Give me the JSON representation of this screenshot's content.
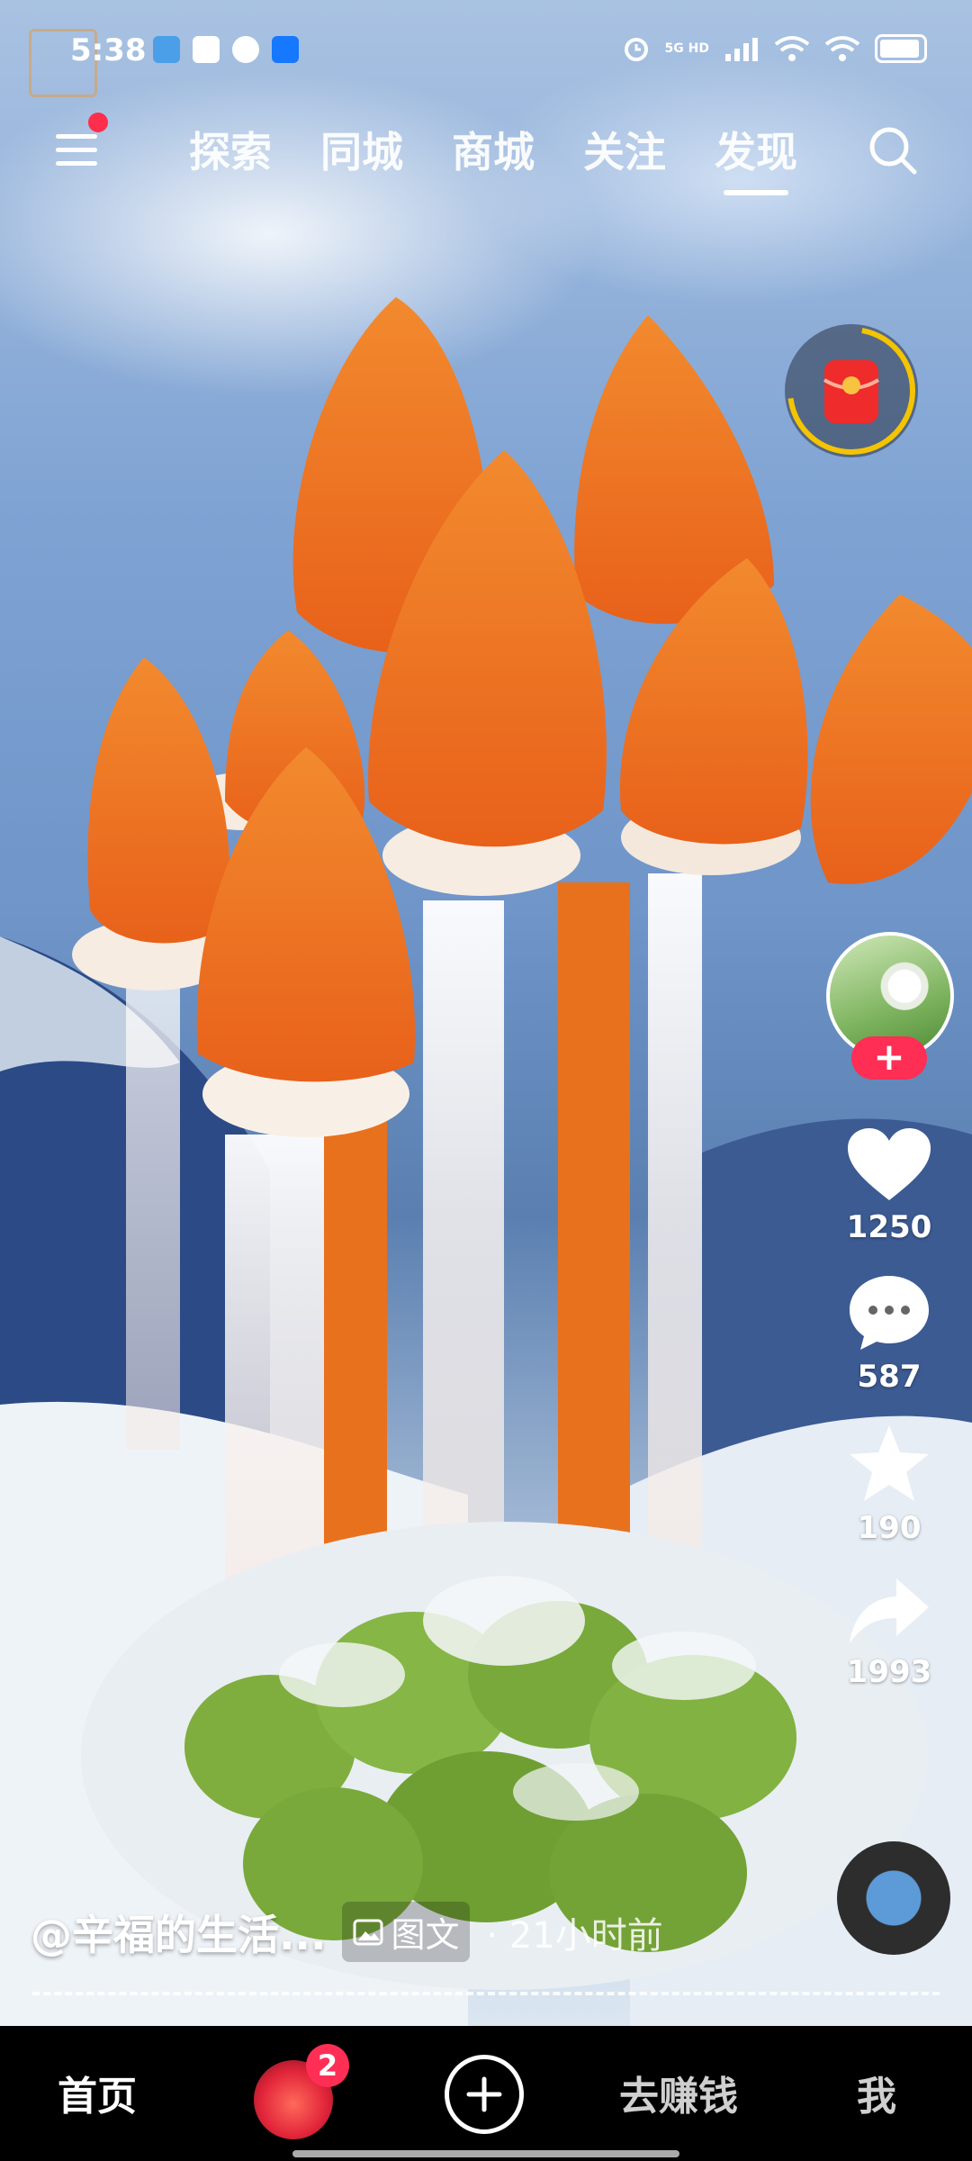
{
  "status_bar": {
    "time": "5:38",
    "network": "5G HD",
    "app_icons": [
      "maps-icon",
      "pinwheel-icon",
      "message-icon",
      "alipay-icon"
    ]
  },
  "top_nav": {
    "tabs": [
      {
        "label": "探索",
        "active": false
      },
      {
        "label": "同城",
        "active": false
      },
      {
        "label": "商城",
        "active": false
      },
      {
        "label": "关注",
        "active": false
      },
      {
        "label": "发现",
        "active": true
      }
    ]
  },
  "side_actions": {
    "follow_label": "+",
    "like_count": "1250",
    "comment_count": "587",
    "favorite_count": "190",
    "share_count": "1993"
  },
  "caption": {
    "author": "@辛福的生活...",
    "type_label": "图文",
    "time_ago": "· 21小时前"
  },
  "bottom_nav": {
    "home": "首页",
    "friends_badge": "2",
    "earn": "去赚钱",
    "me": "我"
  },
  "colors": {
    "accent_red": "#ff2e55",
    "flower_orange": "#f27a22",
    "cactus_green": "#7fae3e"
  }
}
